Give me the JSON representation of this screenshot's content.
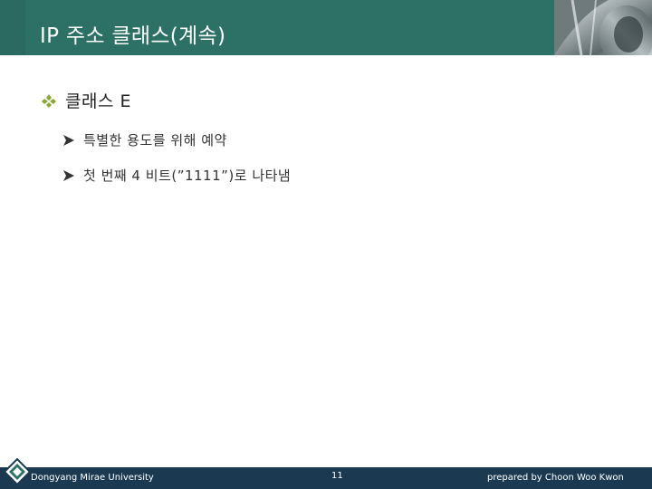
{
  "slide": {
    "title": "IP 주소 클래스(계속)",
    "bullet_level1": "클래스 E",
    "bullets_level2": [
      "특별한 용도를 위해 예약",
      "첫 번째 4 비트(”1111”)로 나타냄"
    ]
  },
  "footer": {
    "left": "Dongyang Mirae University",
    "page_number": "11",
    "right": "prepared by Choon Woo Kwon"
  },
  "colors": {
    "title_bar": "#2d7166",
    "footer_bar": "#1b3a52",
    "bullet_accent": "#8aa832"
  },
  "icons": {
    "level1_bullet": "diamond-bullet-icon",
    "level2_bullet": "arrow-bullet-icon",
    "logo": "diamond-logo-icon"
  }
}
